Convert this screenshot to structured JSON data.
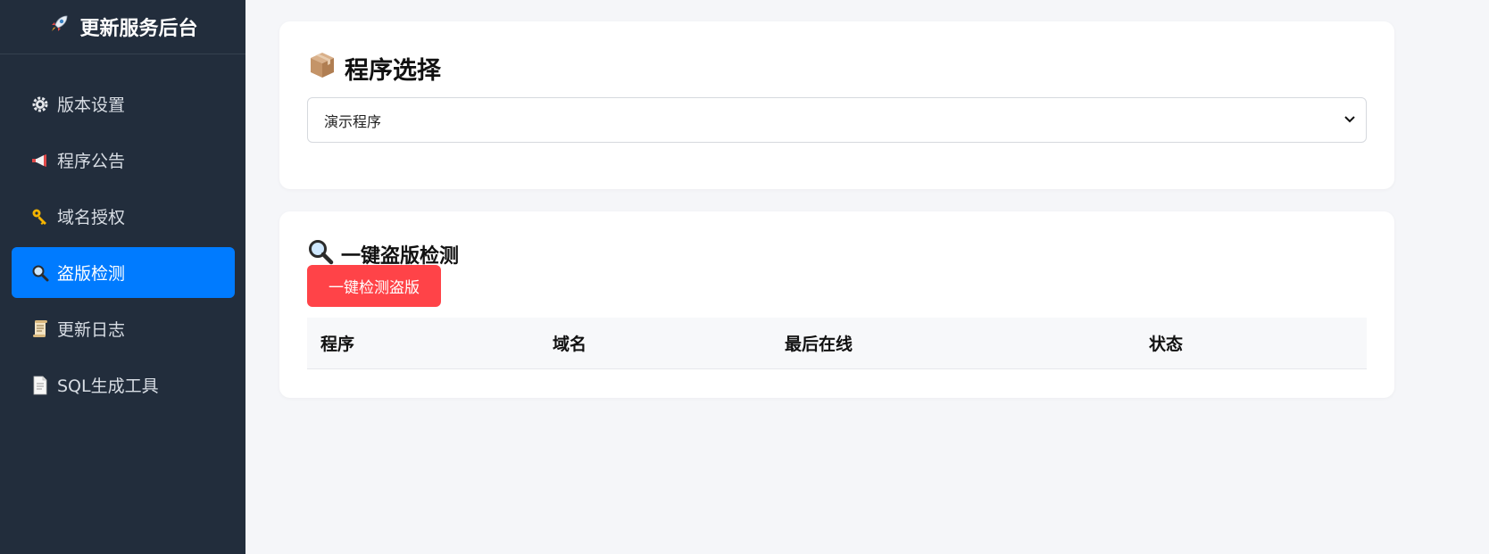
{
  "brand": {
    "title": "更新服务后台",
    "icon": "rocket-icon"
  },
  "sidebar": {
    "items": [
      {
        "label": "版本设置",
        "icon": "gear-icon",
        "active": false
      },
      {
        "label": "程序公告",
        "icon": "megaphone-icon",
        "active": false
      },
      {
        "label": "域名授权",
        "icon": "key-icon",
        "active": false
      },
      {
        "label": "盗版检测",
        "icon": "magnifier-icon",
        "active": true
      },
      {
        "label": "更新日志",
        "icon": "scroll-icon",
        "active": false
      },
      {
        "label": "SQL生成工具",
        "icon": "document-icon",
        "active": false
      }
    ]
  },
  "program_select": {
    "title": "程序选择",
    "icon": "package-icon",
    "selected": "演示程序"
  },
  "piracy_check": {
    "title": "一键盗版检测",
    "icon": "magnifier-icon",
    "button_label": "一键检测盗版",
    "columns": [
      "程序",
      "域名",
      "最后在线",
      "状态"
    ]
  },
  "colors": {
    "sidebar_bg": "#222d3c",
    "active_item": "#007bff",
    "danger_button": "#ff4348",
    "page_bg": "#f5f6f9"
  }
}
